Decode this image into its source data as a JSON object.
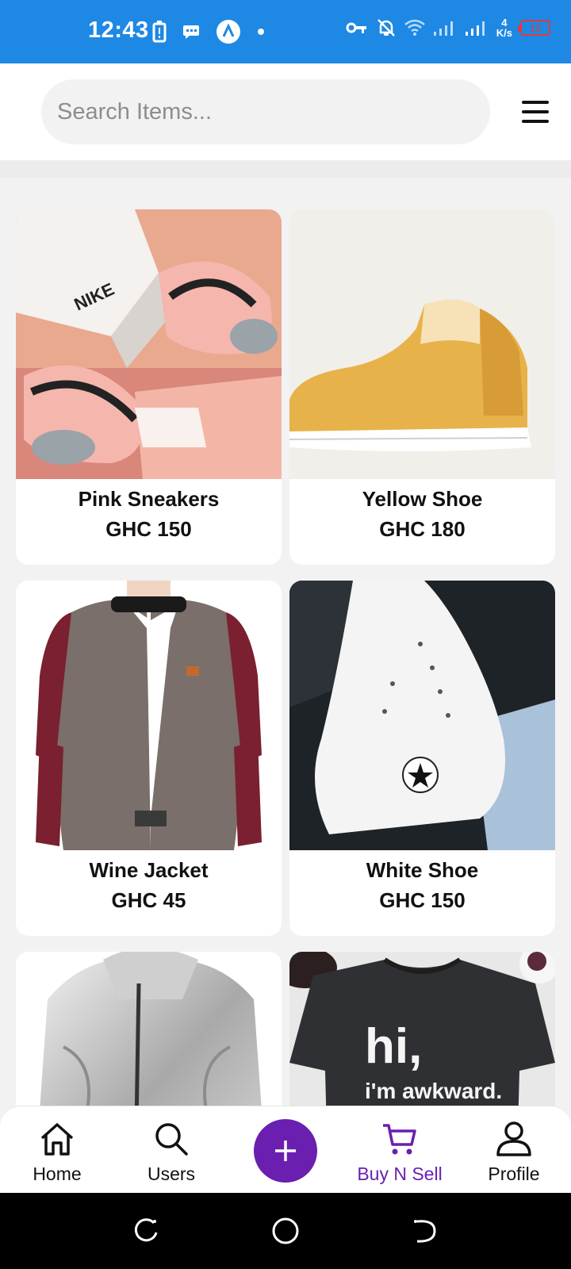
{
  "status_bar": {
    "time": "12:43",
    "network_speed_value": "4",
    "network_speed_unit": "K/s",
    "battery_level": "12"
  },
  "search": {
    "placeholder": "Search Items..."
  },
  "products": [
    {
      "name": "Pink Sneakers",
      "price": "GHC 150",
      "image_icon": "pink-sneakers-photo"
    },
    {
      "name": "Yellow Shoe",
      "price": "GHC 180",
      "image_icon": "yellow-shoe-photo"
    },
    {
      "name": "Wine Jacket",
      "price": "GHC 45",
      "image_icon": "wine-jacket-photo"
    },
    {
      "name": "White Shoe",
      "price": "GHC 150",
      "image_icon": "white-shoe-photo"
    },
    {
      "name": "",
      "price": "",
      "image_icon": "silver-jacket-photo",
      "image_text": ""
    },
    {
      "name": "",
      "price": "",
      "image_icon": "black-tshirt-photo",
      "image_text_line1": "hi,",
      "image_text_line2": "i'm awkward."
    }
  ],
  "bottom_nav": {
    "items": [
      {
        "label": "Home",
        "icon": "home-icon"
      },
      {
        "label": "Users",
        "icon": "search-icon"
      },
      {
        "label": "Buy N Sell",
        "icon": "cart-icon",
        "active": true
      },
      {
        "label": "Profile",
        "icon": "profile-icon"
      }
    ],
    "fab_icon": "plus-icon"
  },
  "colors": {
    "status_bar": "#1e88e5",
    "accent": "#6a1fb0",
    "battery_low": "#e53935"
  }
}
